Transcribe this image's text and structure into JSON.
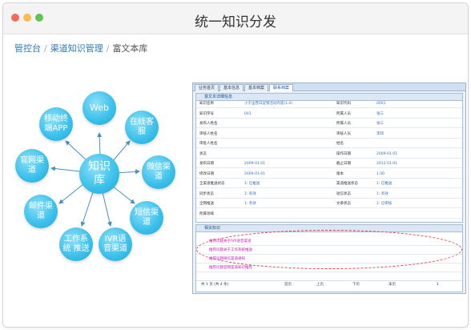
{
  "window": {
    "title": "统一知识分发",
    "dots": {
      "close": "#f46b5d",
      "minimize": "#f9bd4e",
      "maximize": "#5fc454"
    }
  },
  "breadcrumb": {
    "items": [
      "管控台",
      "渠道知识管理",
      "富文本库"
    ],
    "separator": "/"
  },
  "diagram": {
    "center": "知识\n库",
    "nodes": [
      "Web",
      "在线客\n服",
      "微信渠\n道",
      "短信渠\n道",
      "IVR语\n音渠道",
      "工作系\n统 推送",
      "邮件渠\n道",
      "官网渠\n道",
      "移动终\n端APP"
    ]
  },
  "system": {
    "tabs": [
      "业务首页",
      "基本信息",
      "基本档案",
      "联系档案"
    ],
    "detail_header": "富文本详细信息",
    "detail_rows": [
      [
        "知识名称",
        "小于运营日促销活动内容(1.0)",
        "知识代码",
        "0001"
      ],
      [
        "知识序号",
        "001",
        "所属人员",
        "张三"
      ],
      [
        "发布人姓名",
        "",
        "所属人员",
        "张三"
      ],
      [
        "审核人姓名",
        "",
        "审核人员",
        "李四"
      ],
      [
        "审批人姓名",
        "",
        "姓名",
        ""
      ],
      [
        "状态",
        "",
        "操作日期",
        "2009-01-01"
      ],
      [
        "发布日期",
        "2009-01-01",
        "截止日期",
        "2012-01-01"
      ],
      [
        "修改日期",
        "2009-01-01",
        "版本",
        "1.00"
      ],
      [
        "全渠道推送状态",
        "1: 已推送",
        "渠道推送状态",
        "1: 已推送"
      ],
      [
        "同步状态",
        "1: 有效",
        "短信状态",
        "1: 有效"
      ],
      [
        "全网推送",
        "1: 有效",
        "文章状态",
        "1: 已审核"
      ],
      [
        "所属领域",
        "",
        "",
        ""
      ]
    ],
    "list_header": "相关知识",
    "list_rows": [
      "推荐问题关于IVR语音渠道",
      "推荐问题关于工作系统推送",
      "推荐问题微信渠道通知",
      "推荐问题官网渠道知识推荐"
    ],
    "pager": {
      "info": "共 1 页 (共 4 条)",
      "first": "首页",
      "prev": "上页",
      "next": "下页",
      "last": "末页",
      "page": "1"
    }
  }
}
